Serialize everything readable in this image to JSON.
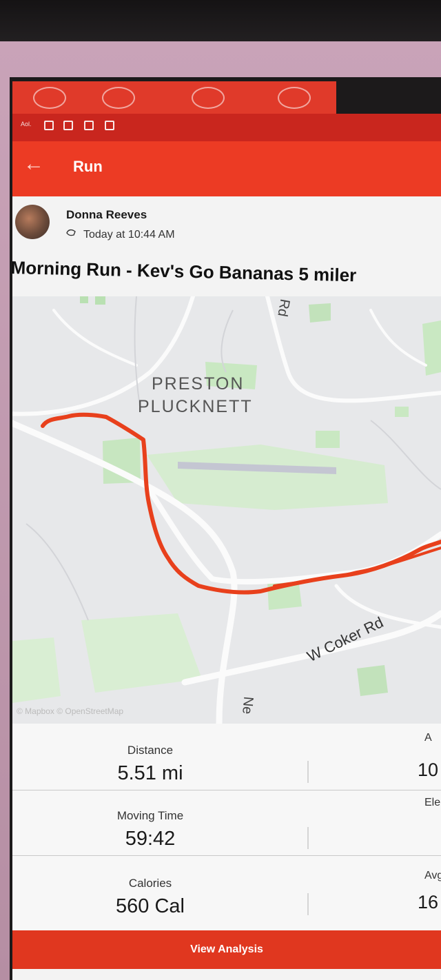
{
  "status_bar": {
    "carrier": "Aol."
  },
  "header": {
    "title": "Run",
    "back_icon": "arrow-left-icon"
  },
  "post": {
    "user_name": "Donna Reeves",
    "timestamp": "Today at 10:44 AM",
    "device_icon": "watch-icon",
    "title": "Morning Run - Kev's Go Bananas 5 miler"
  },
  "map": {
    "area_label_line1": "PRESTON",
    "area_label_line2": "PLUCKNETT",
    "road_coker": "W Coker Rd",
    "road_top": "Rd",
    "road_bottom": "Ne",
    "attribution": "© Mapbox © OpenStreetMap",
    "route_color": "#e8401c"
  },
  "stats": {
    "distance_label": "Distance",
    "distance_value": "5.51 mi",
    "moving_time_label": "Moving Time",
    "moving_time_value": "59:42",
    "calories_label": "Calories",
    "calories_value": "560 Cal",
    "right_label_1": "A",
    "right_value_1": "10",
    "right_label_2": "Ele",
    "right_label_3": "Avg",
    "right_value_3": "16"
  },
  "actions": {
    "view_analysis": "View Analysis"
  },
  "colors": {
    "brand": "#ec3b24",
    "accent_dark": "#c9261e"
  }
}
